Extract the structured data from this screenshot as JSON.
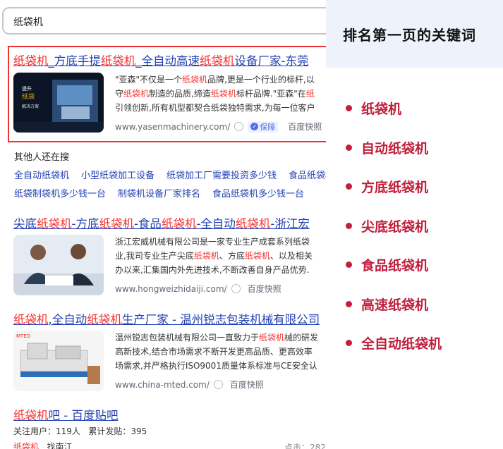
{
  "search": {
    "query": "纸袋机"
  },
  "results": [
    {
      "title_parts": [
        {
          "t": "纸袋机",
          "hl": true
        },
        {
          "t": "_方底手提",
          "hl": false
        },
        {
          "t": "纸袋机",
          "hl": true
        },
        {
          "t": "_全自动高速",
          "hl": false
        },
        {
          "t": "纸袋机",
          "hl": true
        },
        {
          "t": "设备厂家-东莞",
          "hl": false
        }
      ],
      "snippet": [
        [
          {
            "t": "\"亚森\"不仅是一个",
            "hl": false
          },
          {
            "t": "纸袋机",
            "hl": true
          },
          {
            "t": "品牌,更是一个行业的标杆,以",
            "hl": false
          }
        ],
        [
          {
            "t": "守",
            "hl": false
          },
          {
            "t": "纸袋机",
            "hl": true
          },
          {
            "t": "制造的品质,缔造",
            "hl": false
          },
          {
            "t": "纸袋机",
            "hl": true
          },
          {
            "t": "标杆品牌.\"亚森\"在",
            "hl": false
          },
          {
            "t": "纸",
            "hl": true
          }
        ],
        [
          {
            "t": "引领创新,所有机型都契合纸袋独特需求,为每一位客户",
            "hl": false
          }
        ]
      ],
      "url": "www.yasenmachinery.com/",
      "badge": "保障",
      "snapshot": "百度快照",
      "thumb_text": [
        "提升",
        "纸袋",
        "解决方案"
      ]
    },
    {
      "title_parts": [
        {
          "t": "尖底",
          "hl": false
        },
        {
          "t": "纸袋机",
          "hl": true
        },
        {
          "t": "-方底",
          "hl": false
        },
        {
          "t": "纸袋机",
          "hl": true
        },
        {
          "t": "-食品",
          "hl": false
        },
        {
          "t": "纸袋机",
          "hl": true
        },
        {
          "t": "-全自动",
          "hl": false
        },
        {
          "t": "纸袋机",
          "hl": true
        },
        {
          "t": "-浙江宏",
          "hl": false
        }
      ],
      "snippet": [
        [
          {
            "t": "浙江宏威机械有限公司是一家专业生产成套系列纸袋",
            "hl": false
          }
        ],
        [
          {
            "t": "业,我司专业生产尖底",
            "hl": false
          },
          {
            "t": "纸袋机",
            "hl": true
          },
          {
            "t": "、方底",
            "hl": false
          },
          {
            "t": "纸袋机",
            "hl": true
          },
          {
            "t": "、以及相关",
            "hl": false
          }
        ],
        [
          {
            "t": "办以来,汇集国内外先进技术,不断改善自身产品优势.",
            "hl": false
          }
        ]
      ],
      "url": "www.hongweizhidaiji.com/",
      "snapshot": "百度快照"
    },
    {
      "title_parts": [
        {
          "t": "纸袋机",
          "hl": true
        },
        {
          "t": ",全自动",
          "hl": false
        },
        {
          "t": "纸袋机",
          "hl": true
        },
        {
          "t": "生产厂家 - 温州锐志包装机械有限公司",
          "hl": false
        }
      ],
      "snippet": [
        [
          {
            "t": "温州锐志包装机械有限公司一直致力于",
            "hl": false
          },
          {
            "t": "纸袋机",
            "hl": true
          },
          {
            "t": "械的研发",
            "hl": false
          }
        ],
        [
          {
            "t": "高新技术,结合市场需求不断开发更高品质、更高效率",
            "hl": false
          }
        ],
        [
          {
            "t": "场需求,并严格执行ISO9001质量体系标准与CE安全认",
            "hl": false
          }
        ]
      ],
      "url": "www.china-mted.com/",
      "snapshot": "百度快照",
      "thumb_text": [
        "MTED"
      ]
    },
    {
      "title_parts": [
        {
          "t": "纸袋机",
          "hl": true
        },
        {
          "t": "吧 - 百度贴吧",
          "hl": false
        }
      ],
      "stats": "关注用户：119人   累计发贴：395",
      "foot_left": [
        {
          "t": "纸袋机",
          "hl": true
        },
        {
          "t": "   找南江",
          "hl": false
        }
      ],
      "foot_right": "点击：282"
    }
  ],
  "related": {
    "heading": "其他人还在搜",
    "row1": [
      "全自动纸袋机",
      "小型纸袋加工设备",
      "纸袋加工厂需要投资多少钱",
      "食品纸袋机"
    ],
    "row2": [
      "纸袋制袋机多少钱一台",
      "制袋机设备厂家排名",
      "食品纸袋机多少钱一台"
    ]
  },
  "panel": {
    "title": "排名第一页的关键词",
    "keywords": [
      "纸袋机",
      "自动纸袋机",
      "方底纸袋机",
      "尖底纸袋机",
      "食品纸袋机",
      "高速纸袋机",
      "全自动纸袋机"
    ],
    "accent": "#c0203c",
    "header_bg": "#eef2fa"
  }
}
